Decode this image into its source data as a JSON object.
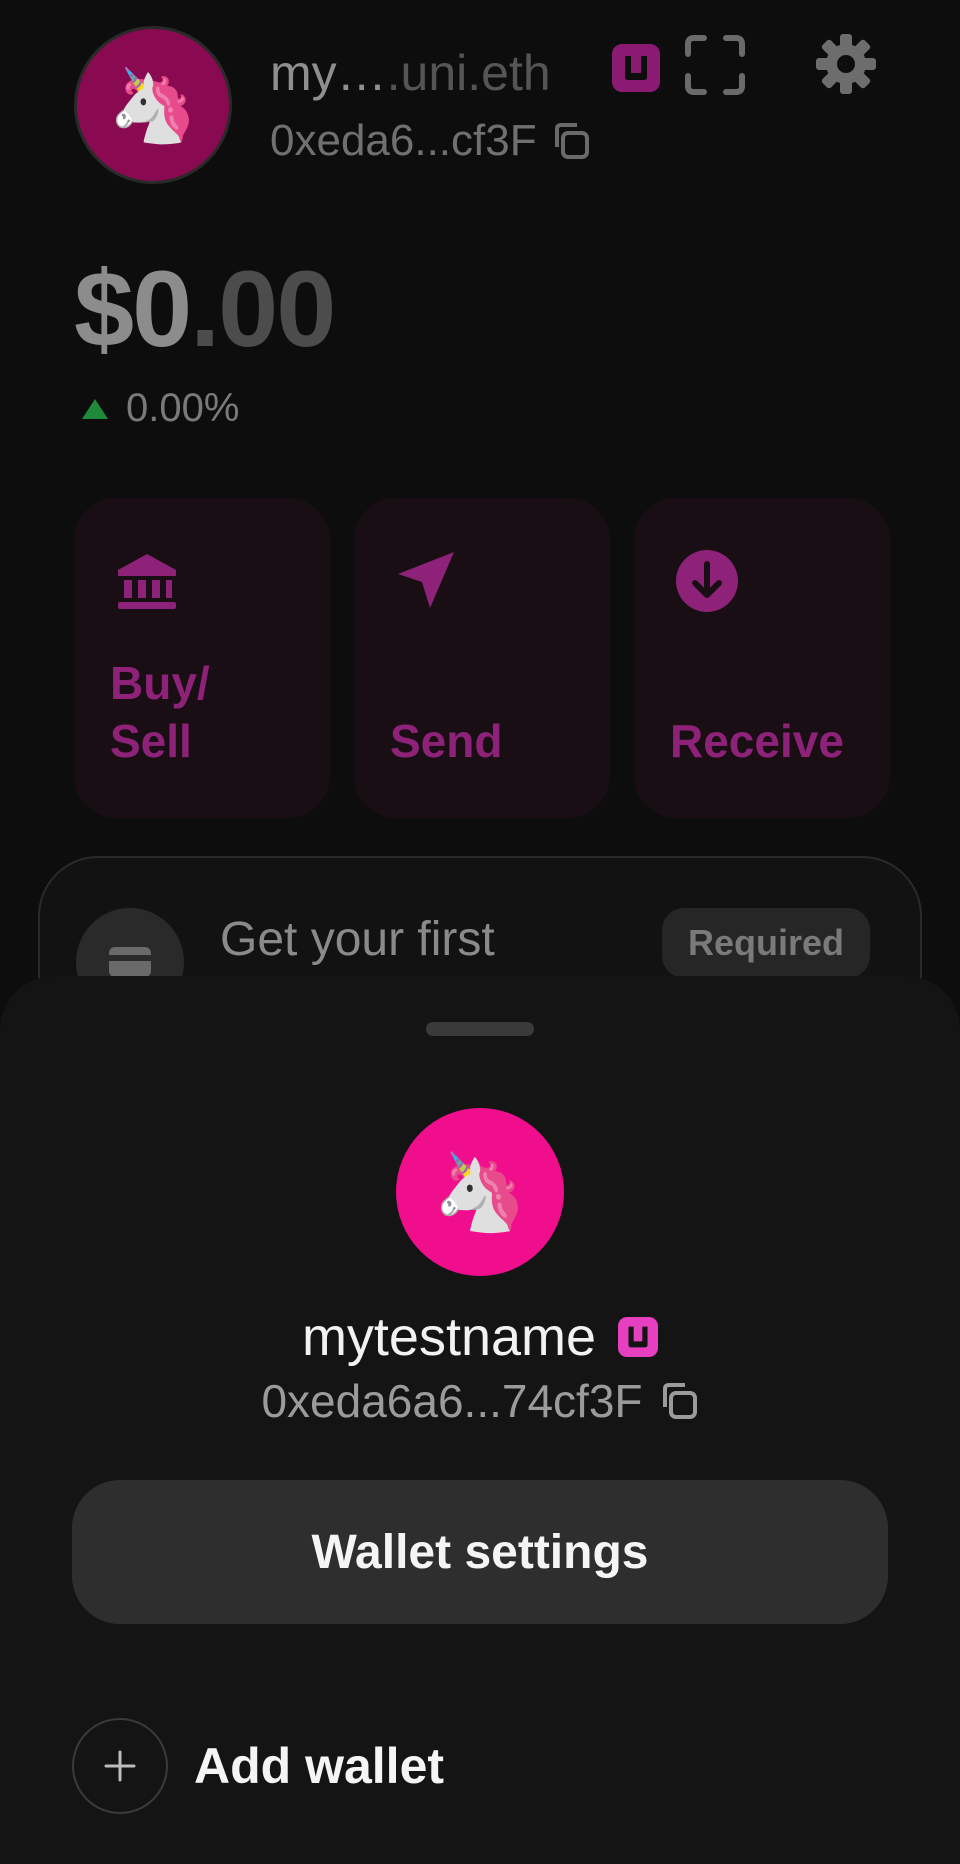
{
  "home": {
    "avatar_emoji": "🦄",
    "account_name_start": "my…",
    "account_name_end": ".uni.eth",
    "address": "0xeda6...cf3F",
    "balance_whole": "$0",
    "balance_cents": ".00",
    "change": "0.00%",
    "actions": [
      {
        "label": "Buy/\nSell",
        "icon": "bank-icon"
      },
      {
        "label": "Send",
        "icon": "send-icon"
      },
      {
        "label": "Receive",
        "icon": "receive-icon"
      }
    ],
    "card": {
      "title": "Get your first",
      "badge": "Required"
    }
  },
  "sheet": {
    "avatar_emoji": "🦄",
    "name": "mytestname",
    "address": "0xeda6a6...74cf3F",
    "wallet_settings_label": "Wallet settings",
    "add_wallet_label": "Add wallet"
  },
  "colors": {
    "accent": "#8e2278",
    "pink": "#f00e8c",
    "positive": "#1f8a3a",
    "sheet_bg": "#141414"
  }
}
